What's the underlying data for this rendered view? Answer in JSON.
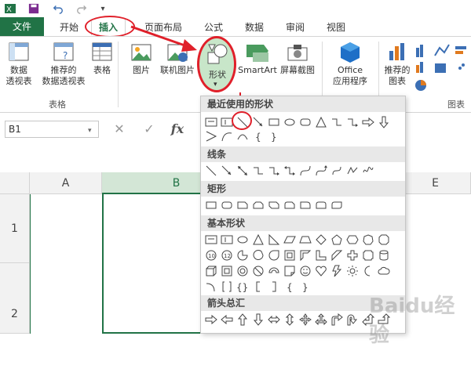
{
  "quick_access": {
    "app_icon": "excel-icon",
    "save_icon": "save-icon",
    "undo_icon": "undo-icon",
    "redo_icon": "redo-icon",
    "customize_icon": "customize-icon"
  },
  "tabs": [
    {
      "label": "文件"
    },
    {
      "label": "开始"
    },
    {
      "label": "插入"
    },
    {
      "label": "页面布局"
    },
    {
      "label": "公式"
    },
    {
      "label": "数据"
    },
    {
      "label": "审阅"
    },
    {
      "label": "视图"
    }
  ],
  "ribbon": {
    "pivot_table": "数据\n透视表",
    "recommended_pivot": "推荐的\n数据透视表",
    "table": "表格",
    "tables_group": "表格",
    "picture": "图片",
    "online_picture": "联机图片",
    "shapes": "形状",
    "smartart": "SmartArt",
    "screenshot": "屏幕截图",
    "office_apps": "Office\n应用程序",
    "recommended_charts": "推荐的\n图表",
    "charts_group": "图表"
  },
  "formula_bar": {
    "namebox": "B1",
    "cancel_icon": "cancel-icon",
    "enter_icon": "enter-icon",
    "fx": "fx"
  },
  "grid": {
    "columns": [
      "A",
      "B",
      "E"
    ],
    "rows": [
      "1",
      "2"
    ]
  },
  "dropdown": {
    "sections": [
      {
        "title": "最近使用的形状"
      },
      {
        "title": "线条"
      },
      {
        "title": "矩形"
      },
      {
        "title": "基本形状"
      },
      {
        "title": "箭头总汇"
      }
    ]
  },
  "watermark": "Baidu经验",
  "colors": {
    "excel_green": "#217346",
    "highlight_red": "#e0202a",
    "shapes_highlight": "#c8e6c9"
  }
}
